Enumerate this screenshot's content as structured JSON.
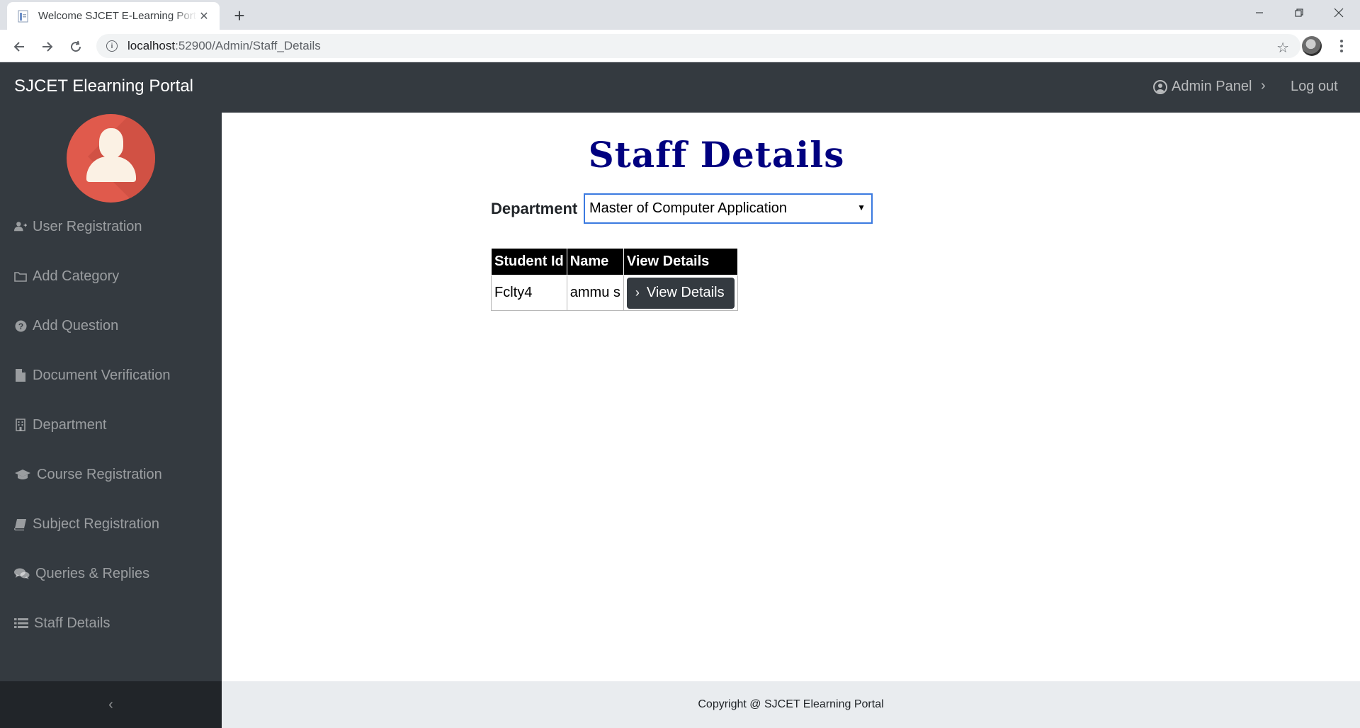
{
  "browser": {
    "tab_title": "Welcome SJCET E-Learning Portal",
    "tab_close": "✕",
    "new_tab": "+",
    "url_host": "localhost",
    "url_path": ":52900/Admin/Staff_Details"
  },
  "header": {
    "brand": "SJCET Elearning Portal",
    "admin_panel": "Admin Panel",
    "chevron": "›",
    "logout": "Log out"
  },
  "sidebar": {
    "items": [
      {
        "label": "User Registration",
        "icon": "user-plus-icon"
      },
      {
        "label": "Add Category",
        "icon": "folder-icon"
      },
      {
        "label": "Add Question",
        "icon": "question-circle-icon"
      },
      {
        "label": "Document Verification",
        "icon": "file-icon"
      },
      {
        "label": "Department",
        "icon": "building-icon"
      },
      {
        "label": "Course Registration",
        "icon": "graduation-cap-icon"
      },
      {
        "label": "Subject Registration",
        "icon": "book-icon"
      },
      {
        "label": "Queries & Replies",
        "icon": "comments-icon"
      },
      {
        "label": "Staff Details",
        "icon": "list-icon"
      }
    ],
    "collapse": "‹"
  },
  "main": {
    "title": "Staff Details",
    "department_label": "Department",
    "department_value": "Master of Computer Application",
    "table": {
      "headers": [
        "Student Id",
        "Name",
        "View Details"
      ],
      "rows": [
        {
          "id": "Fclty4",
          "name": "ammu s",
          "action": "View Details"
        }
      ]
    }
  },
  "footer": {
    "copyright": "Copyright @ SJCET Elearning Portal"
  }
}
